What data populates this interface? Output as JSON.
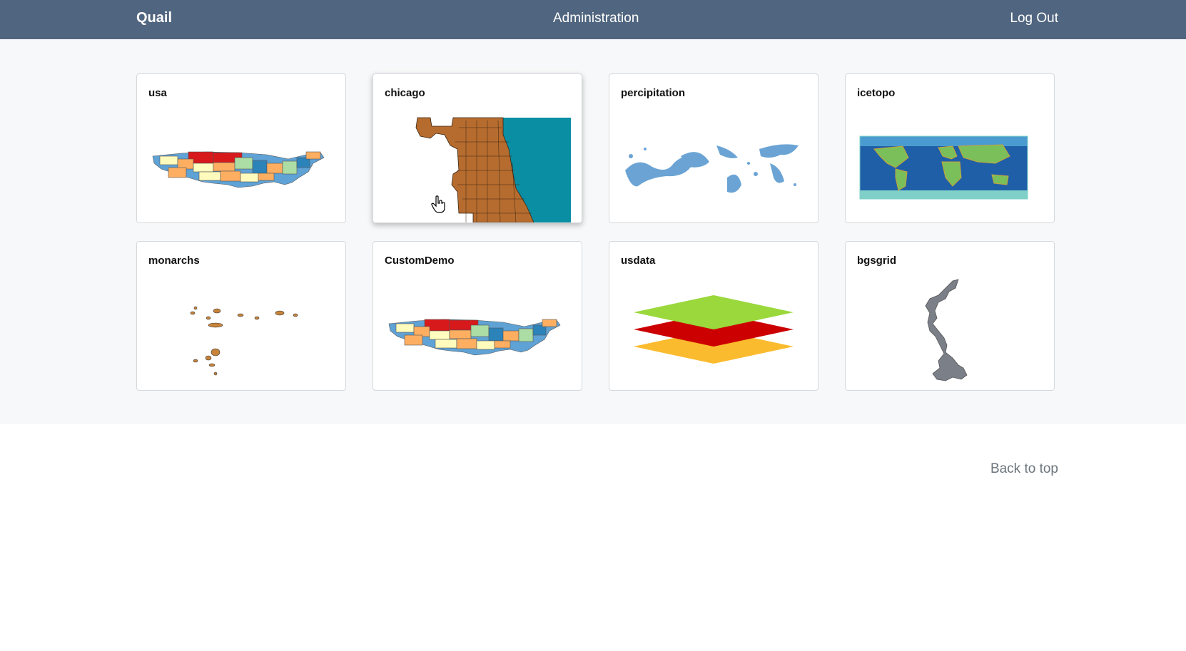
{
  "navbar": {
    "brand": "Quail",
    "admin": "Administration",
    "logout": "Log Out"
  },
  "cards": [
    {
      "title": "usa",
      "thumb": "usa-choropleth-map"
    },
    {
      "title": "chicago",
      "thumb": "chicago-map"
    },
    {
      "title": "percipitation",
      "thumb": "precipitation-map"
    },
    {
      "title": "icetopo",
      "thumb": "world-topography-map"
    },
    {
      "title": "monarchs",
      "thumb": "island-points-map"
    },
    {
      "title": "CustomDemo",
      "thumb": "usa-choropleth-map"
    },
    {
      "title": "usdata",
      "thumb": "stacked-layers-icon"
    },
    {
      "title": "bgsgrid",
      "thumb": "great-britain-map"
    }
  ],
  "footer": {
    "back_to_top": "Back to top"
  },
  "colors": {
    "navbar": "#50657f",
    "page_bg": "#f7f8f9",
    "layer_green": "#9ad83c",
    "layer_red": "#cc0000",
    "layer_yellow": "#fbbb2e"
  }
}
